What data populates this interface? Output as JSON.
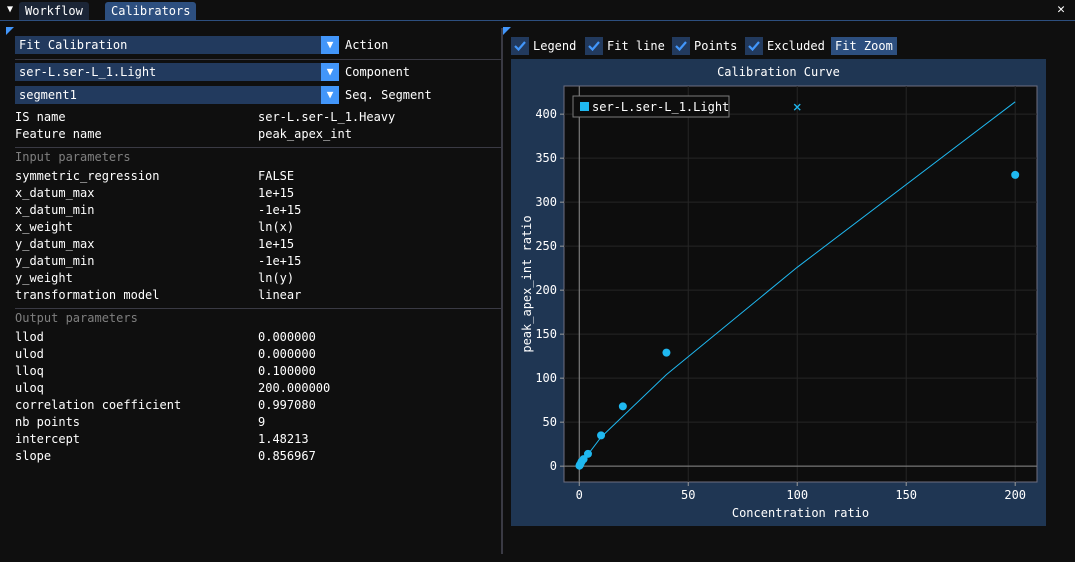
{
  "tabs": [
    {
      "label": "Workflow",
      "active": false
    },
    {
      "label": "Calibrators",
      "active": true
    }
  ],
  "window": {
    "close_glyph": "✕",
    "menu_glyph": "▼"
  },
  "left": {
    "action": {
      "value": "Fit Calibration",
      "label": "Action"
    },
    "component": {
      "value": "ser-L.ser-L_1.Light",
      "label": "Component"
    },
    "segment": {
      "value": "segment1",
      "label": "Seq. Segment"
    },
    "info": [
      {
        "key": "IS name",
        "value": "ser-L.ser-L_1.Heavy"
      },
      {
        "key": "Feature name",
        "value": "peak_apex_int"
      }
    ],
    "input_title": "Input parameters",
    "input_params": [
      {
        "key": "symmetric_regression",
        "value": "FALSE"
      },
      {
        "key": "x_datum_max",
        "value": "1e+15"
      },
      {
        "key": "x_datum_min",
        "value": "-1e+15"
      },
      {
        "key": "x_weight",
        "value": "ln(x)"
      },
      {
        "key": "y_datum_max",
        "value": "1e+15"
      },
      {
        "key": "y_datum_min",
        "value": "-1e+15"
      },
      {
        "key": "y_weight",
        "value": "ln(y)"
      },
      {
        "key": "transformation model",
        "value": "linear"
      }
    ],
    "output_title": "Output parameters",
    "output_params": [
      {
        "key": "llod",
        "value": "0.000000"
      },
      {
        "key": "ulod",
        "value": "0.000000"
      },
      {
        "key": "lloq",
        "value": "0.100000"
      },
      {
        "key": "uloq",
        "value": "200.000000"
      },
      {
        "key": "correlation coefficient",
        "value": "0.997080"
      },
      {
        "key": "nb points",
        "value": "9"
      },
      {
        "key": "intercept",
        "value": "1.48213"
      },
      {
        "key": "slope",
        "value": "0.856967"
      }
    ]
  },
  "right": {
    "checkboxes": [
      {
        "label": "Legend",
        "checked": true
      },
      {
        "label": "Fit line",
        "checked": true
      },
      {
        "label": "Points",
        "checked": true
      },
      {
        "label": "Excluded",
        "checked": true
      }
    ],
    "fit_zoom_label": "Fit Zoom"
  },
  "colors": {
    "accent": "#4296fa",
    "series": "#1fb8f0",
    "combo_bg": "#223a5e",
    "plot_bg": "#1f3653",
    "plot_area_bg": "#0d0d0d"
  },
  "chart_data": {
    "type": "scatter",
    "title": "Calibration Curve",
    "xlabel": "Concentration ratio",
    "ylabel": "peak_apex_int ratio",
    "xlim": [
      -7,
      210
    ],
    "ylim": [
      -18,
      432
    ],
    "xticks": [
      0,
      50,
      100,
      150,
      200
    ],
    "yticks": [
      0,
      50,
      100,
      150,
      200,
      250,
      300,
      350,
      400
    ],
    "grid": true,
    "legend": {
      "position": "top-left",
      "entries": [
        "ser-L.ser-L_1.Light"
      ]
    },
    "series": [
      {
        "name": "ser-L.ser-L_1.Light",
        "points": [
          {
            "x": 0.1,
            "y": 0.5
          },
          {
            "x": 0.25,
            "y": 1.2
          },
          {
            "x": 0.5,
            "y": 2.4
          },
          {
            "x": 1,
            "y": 5
          },
          {
            "x": 2,
            "y": 8
          },
          {
            "x": 4,
            "y": 14
          },
          {
            "x": 10,
            "y": 35
          },
          {
            "x": 20,
            "y": 68
          },
          {
            "x": 40,
            "y": 129
          },
          {
            "x": 200,
            "y": 331
          }
        ],
        "fit_line": [
          {
            "x": 0.1,
            "y": 0.5
          },
          {
            "x": 10,
            "y": 33
          },
          {
            "x": 40,
            "y": 104
          },
          {
            "x": 100,
            "y": 226
          },
          {
            "x": 200,
            "y": 414
          }
        ],
        "excluded": [
          {
            "x": 100,
            "y": 408
          }
        ]
      }
    ]
  }
}
